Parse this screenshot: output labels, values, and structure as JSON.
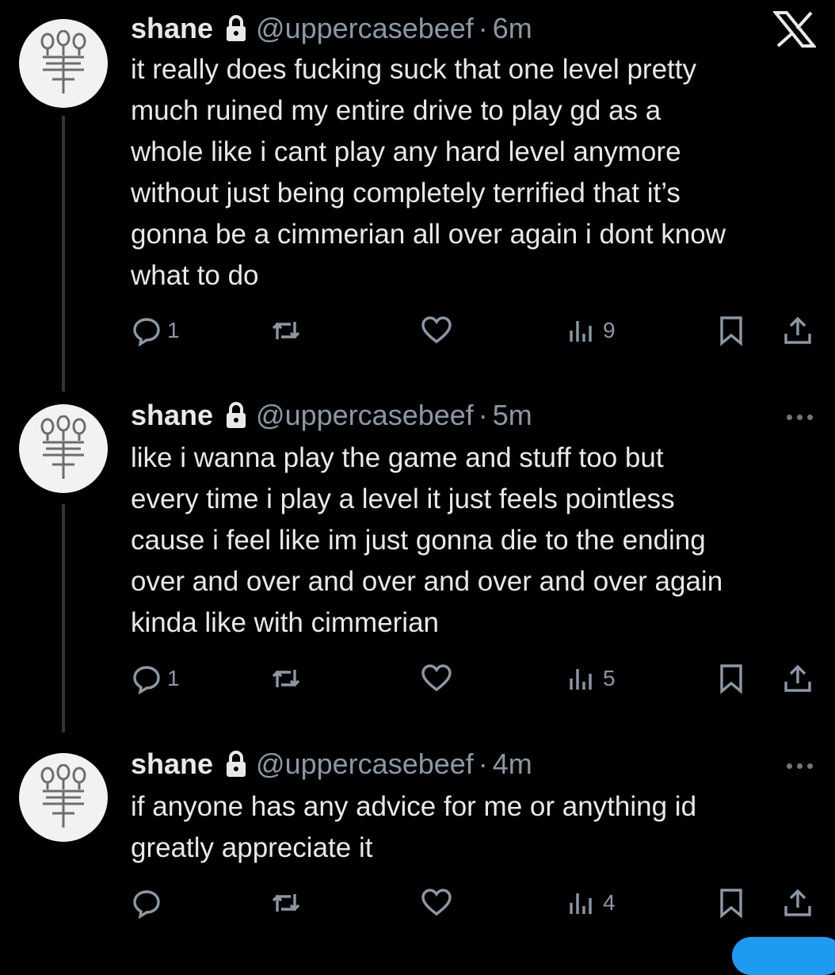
{
  "tweets": [
    {
      "name": "shane",
      "handle": "@uppercasebeef",
      "dot": "·",
      "time": "6m",
      "text": "it really does fucking suck that one level pretty\nmuch ruined my entire drive to play gd as a\nwhole like i cant play any hard level anymore\nwithout just being completely terrified that it’s\ngonna be a cimmerian all over again i dont know\nwhat to do",
      "replies": "1",
      "views": "9",
      "corner_icon": "x-logo-icon"
    },
    {
      "name": "shane",
      "handle": "@uppercasebeef",
      "dot": "·",
      "time": "5m",
      "text": "like i wanna play the game and stuff too but\nevery time i play a level it just feels pointless\ncause i feel like im just gonna die to the ending\nover and over and over and over and over again\nkinda like with cimmerian",
      "replies": "1",
      "views": "5",
      "corner_icon": "more-icon"
    },
    {
      "name": "shane",
      "handle": "@uppercasebeef",
      "dot": "·",
      "time": "4m",
      "text": "if anyone has any advice for me or anything id\ngreatly appreciate it",
      "replies": "",
      "views": "4",
      "corner_icon": "more-icon"
    }
  ],
  "colors": {
    "background": "#000000",
    "text": "#e7e9ea",
    "muted": "#8b98a5",
    "accent": "#1d9bf0"
  }
}
